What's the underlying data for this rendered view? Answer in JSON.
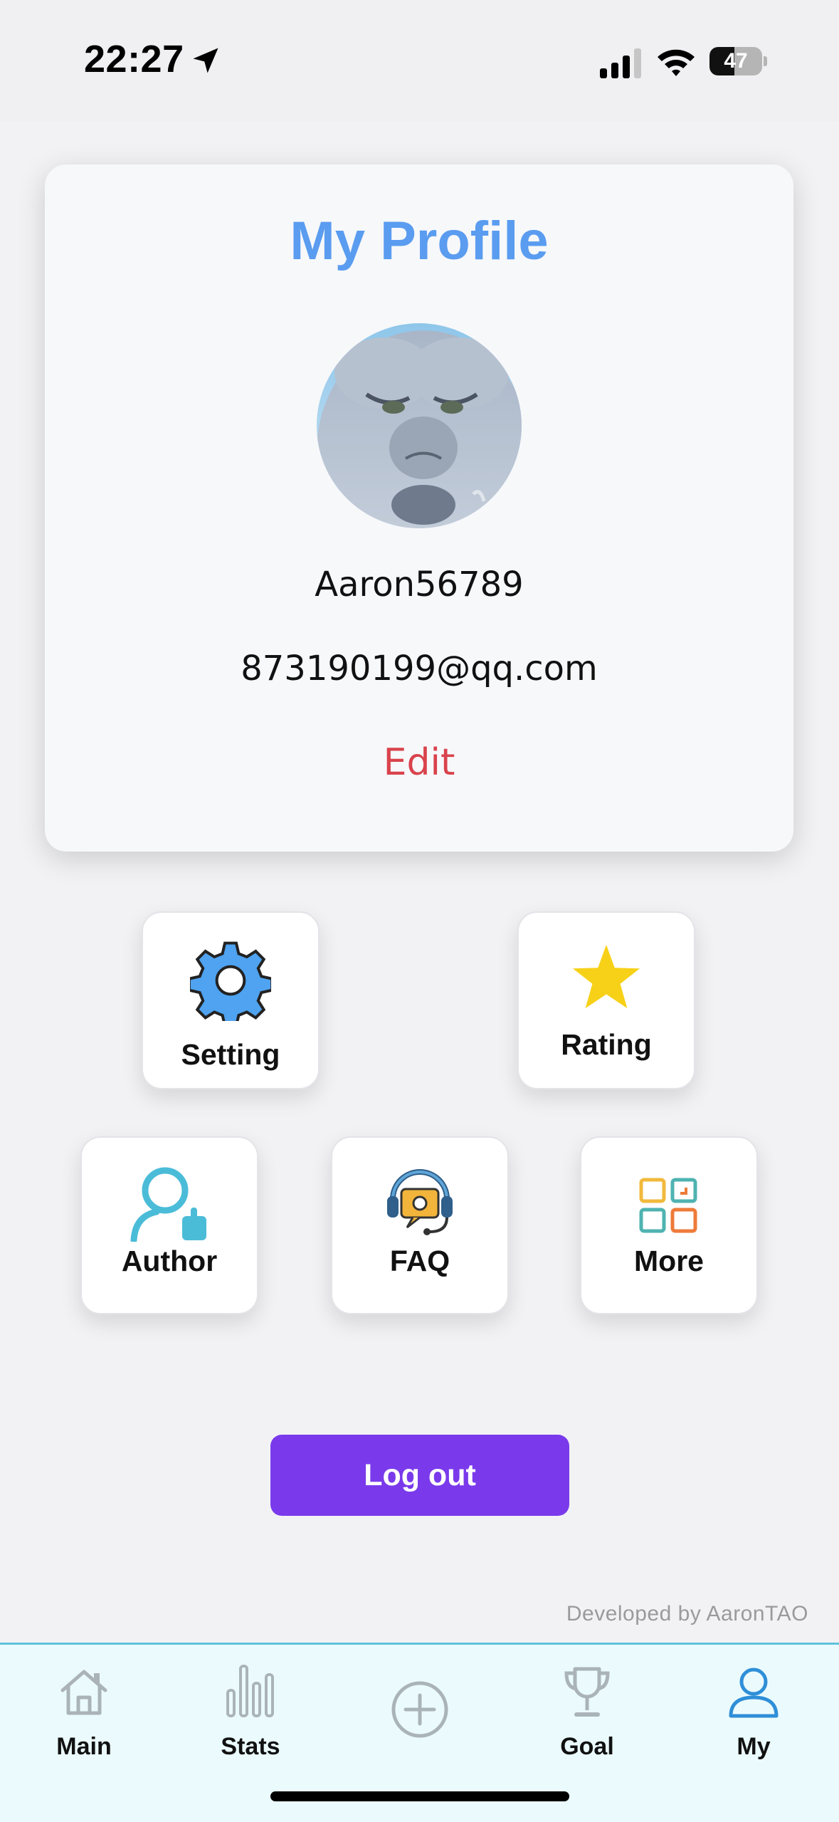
{
  "status_bar": {
    "time": "22:27",
    "battery_level": "47"
  },
  "profile": {
    "title": "My Profile",
    "username": "Aaron56789",
    "email": "873190199@qq.com",
    "edit_label": "Edit"
  },
  "tiles": {
    "setting": "Setting",
    "rating": "Rating",
    "author": "Author",
    "faq": "FAQ",
    "more": "More"
  },
  "logout_label": "Log out",
  "developer_note": "Developed by AaronTAO",
  "tab_bar": {
    "main": "Main",
    "stats": "Stats",
    "goal": "Goal",
    "my": "My",
    "active": "my"
  },
  "colors": {
    "title": "#5a9cf0",
    "edit": "#d9434c",
    "logout": "#7a3aeb",
    "tab_active": "#2f8fd8",
    "tab_inactive": "#aab4b8"
  },
  "icons": {
    "setting": "gear-icon",
    "rating": "star-icon",
    "author": "person-icon",
    "faq": "support-headset-icon",
    "more": "grid-icon",
    "main": "home-icon",
    "stats": "bar-chart-icon",
    "add": "plus-circle-icon",
    "goal": "trophy-icon",
    "my": "person-icon"
  }
}
